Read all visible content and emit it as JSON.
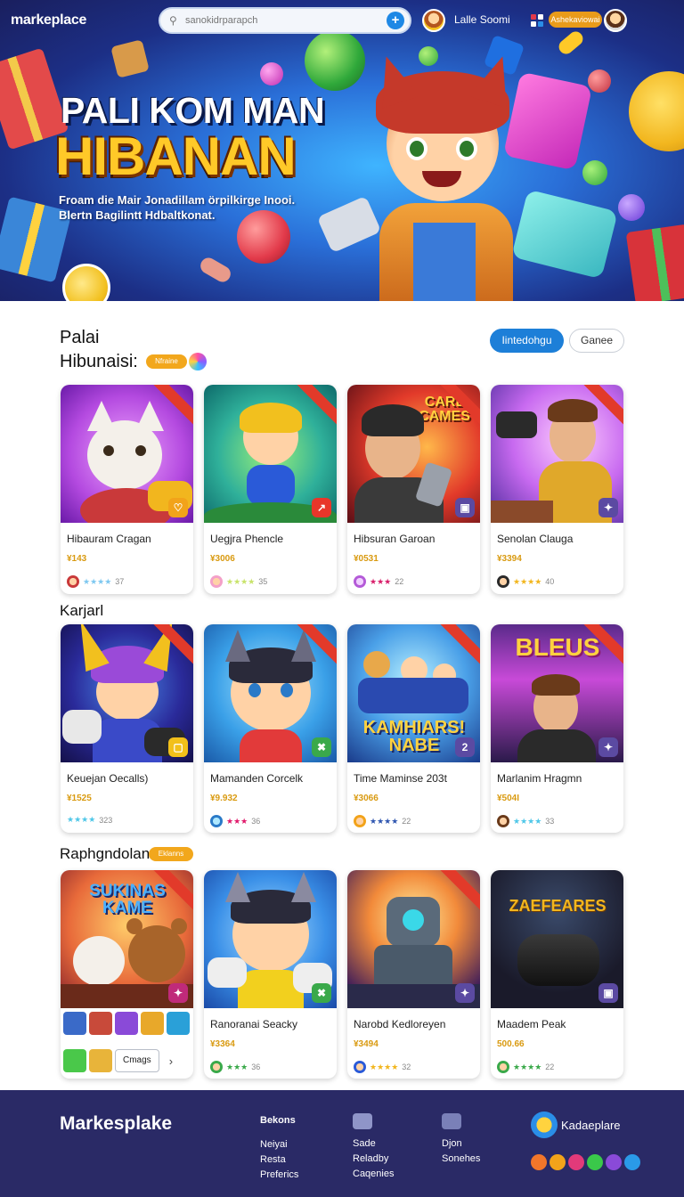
{
  "app": {
    "logo": "markeplace"
  },
  "search": {
    "placeholder": "sanokidrparapch"
  },
  "header": {
    "user_name": "Lalle Soomi",
    "badge": "Ashekaviowai"
  },
  "hero": {
    "title_line1": "PALI KOM MAN",
    "title_line2": "HIBANAN",
    "subtitle": "Froam die Mair Jonadillam örpilkirge Inooi. Blertn Bagilintt Hdbaltkonat."
  },
  "section": {
    "heading_line1": "Palai",
    "heading_line2": "Hibunaisi:",
    "new_tag": "Nfraine",
    "primary_button": "Iintedohgu",
    "secondary_button": "Ganee"
  },
  "rows": [
    {
      "title": ""
    },
    {
      "title": "Karjarl"
    },
    {
      "title": "Raphgndolan",
      "tag": "Eklanns"
    }
  ],
  "cards": [
    {
      "title": "Hibauram Cragan",
      "price": "¥143",
      "rating": "★★★★",
      "count": "37",
      "star_color": "#7ec8f0",
      "badge": "♡",
      "badge_color": "#f2a31a"
    },
    {
      "title": "Uegjra Phencle",
      "price": "¥3006",
      "rating": "★★★★",
      "count": "35",
      "star_color": "#c8e36a",
      "badge": "↗",
      "badge_color": "#e8362a"
    },
    {
      "title": "Hibsuran Garoan",
      "price": "¥0531",
      "rating": "★★★",
      "count": "22",
      "star_color": "#d81e6a",
      "badge": "▣",
      "badge_color": "#5b4aa2"
    },
    {
      "title": "Senolan Clauga",
      "price": "¥3394",
      "rating": "★★★★",
      "count": "40",
      "star_color": "#f2b61e",
      "badge": "✦",
      "badge_color": "#5b4aa2"
    },
    {
      "title": "Keuejan Oecalls)",
      "price": "¥1525",
      "rating": "★★★★",
      "count": "323",
      "star_color": "#4fc7e8",
      "badge": "▢",
      "badge_color": "#f2c01a"
    },
    {
      "title": "Mamanden Corcelk",
      "price": "¥9.932",
      "rating": "★★★",
      "count": "36",
      "star_color": "#e0186a",
      "badge": "✖",
      "badge_color": "#3aa94a"
    },
    {
      "title": "Time Maminse 203t",
      "price": "¥3066",
      "rating": "★★★★",
      "count": "22",
      "star_color": "#2f56b0",
      "badge": "2",
      "badge_color": "#5b4aa2"
    },
    {
      "title": "Marlanim Hragmn",
      "price": "¥504I",
      "rating": "★★★★",
      "count": "33",
      "star_color": "#4fc7e8",
      "badge": "✦",
      "badge_color": "#5b4aa2"
    },
    {
      "title": "",
      "price": "",
      "rating": "",
      "count": "",
      "star_color": "#f2b61e",
      "badge": "✦",
      "badge_color": "#c02a7a"
    },
    {
      "title": "Ranoranai Seacky",
      "price": "¥3364",
      "rating": "★★★",
      "count": "36",
      "star_color": "#3aa94a",
      "badge": "✖",
      "badge_color": "#3aa94a"
    },
    {
      "title": "Narobd Kedloreyen",
      "price": "¥3494",
      "rating": "★★★★",
      "count": "32",
      "star_color": "#f2b61e",
      "badge": "✦",
      "badge_color": "#5b4aa2"
    },
    {
      "title": "Maadem Peak",
      "price": "500.66",
      "rating": "★★★★",
      "count": "22",
      "star_color": "#3aa94a",
      "badge": "▣",
      "badge_color": "#5b4aa2"
    }
  ],
  "thumb_texts": {
    "card3": "CARL CAMES",
    "card8": "BLEUS",
    "card7": "KAMHIARS! NABE",
    "card9": "SUKINAS KAME",
    "card12": "ZAEFEARES"
  },
  "strip": {
    "button_label": "Cmags",
    "chevron": "›"
  },
  "footer": {
    "brand": "Markesplake",
    "col1": {
      "heading": "Bekons",
      "items": [
        "Neiyai",
        "Resta",
        "Preferics"
      ]
    },
    "col2": {
      "items": [
        "Sade",
        "Reladby",
        "Caqenies"
      ]
    },
    "col3": {
      "items": [
        "Djon",
        "Sonehes"
      ]
    },
    "right_brand": "Kadaeplare"
  },
  "colors": {
    "accent": "#1d7fd8",
    "footer_bg": "#2a2a66",
    "price": "#d99a10",
    "tag": "#f2a71c"
  }
}
